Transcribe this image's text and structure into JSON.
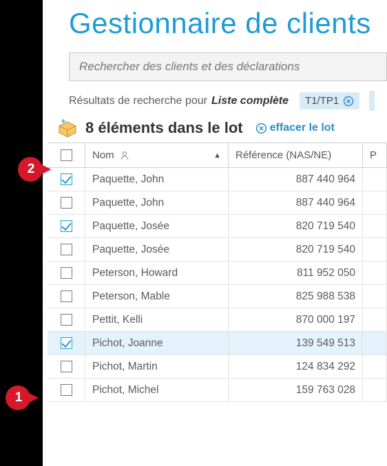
{
  "title": "Gestionnaire de clients",
  "search": {
    "placeholder": "Rechercher des clients et des déclarations"
  },
  "results": {
    "label": "Résultats de recherche pour",
    "value": "Liste complète",
    "chip": "T1/TP1"
  },
  "batch": {
    "title": "8 éléments dans le lot",
    "clear_label": "effacer le lot"
  },
  "columns": {
    "name": "Nom",
    "ref": "Référence (NAS/NE)",
    "p": "P"
  },
  "rows": [
    {
      "name": "Paquette, John",
      "ref": "887 440 964",
      "checked": true,
      "selected": false
    },
    {
      "name": "Paquette, John",
      "ref": "887 440 964",
      "checked": false,
      "selected": false
    },
    {
      "name": "Paquette, Josée",
      "ref": "820 719 540",
      "checked": true,
      "selected": false
    },
    {
      "name": "Paquette, Josée",
      "ref": "820 719 540",
      "checked": false,
      "selected": false
    },
    {
      "name": "Peterson, Howard",
      "ref": "811 952 050",
      "checked": false,
      "selected": false
    },
    {
      "name": "Peterson, Mable",
      "ref": "825 988 538",
      "checked": false,
      "selected": false
    },
    {
      "name": "Pettit, Kelli",
      "ref": "870 000 197",
      "checked": false,
      "selected": false
    },
    {
      "name": "Pichot, Joanne",
      "ref": "139 549 513",
      "checked": true,
      "selected": true
    },
    {
      "name": "Pichot, Martin",
      "ref": "124 834 292",
      "checked": false,
      "selected": false
    },
    {
      "name": "Pichot, Michel",
      "ref": "159 763 028",
      "checked": false,
      "selected": false
    }
  ],
  "callouts": {
    "one": "1",
    "two": "2"
  }
}
